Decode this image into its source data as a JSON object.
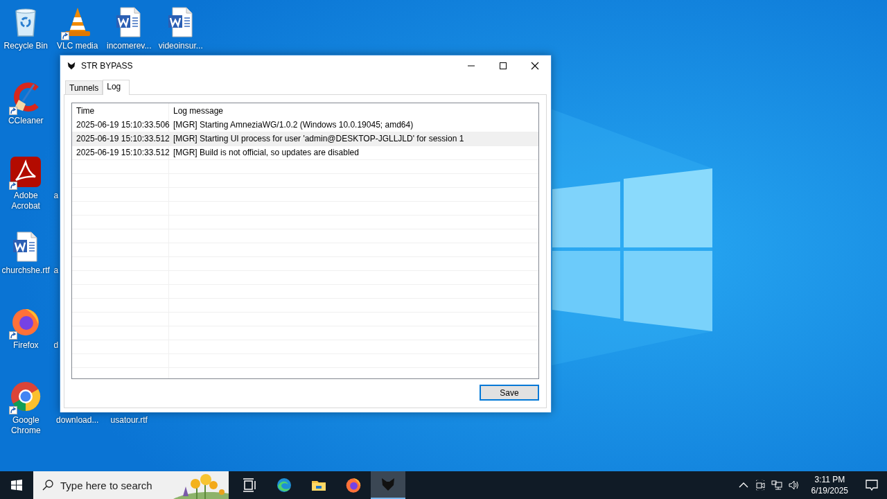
{
  "desktop": {
    "columns": [
      [
        {
          "kind": "recycle_bin",
          "label": "Recycle Bin"
        },
        {
          "kind": "ccleaner",
          "label": "CCleaner",
          "shortcut": true
        },
        {
          "kind": "acrobat",
          "label": "Adobe Acrobat",
          "shortcut": true
        },
        {
          "kind": "word",
          "label": "churchshe.rtf"
        },
        {
          "kind": "firefox",
          "label": "Firefox",
          "shortcut": true
        },
        {
          "kind": "chrome",
          "label": "Google Chrome",
          "shortcut": true
        }
      ],
      [
        {
          "kind": "vlc",
          "label": "VLC media",
          "shortcut": true
        },
        null,
        {
          "kind": "cut",
          "label": "a"
        },
        {
          "kind": "cut",
          "label": "a"
        },
        {
          "kind": "cut",
          "label": "d"
        },
        {
          "kind": "covered",
          "label": "download..."
        }
      ],
      [
        {
          "kind": "word",
          "label": "incomerev..."
        },
        null,
        null,
        null,
        null,
        {
          "kind": "covered",
          "label": "usatour.rtf"
        }
      ],
      [
        {
          "kind": "word",
          "label": "videoinsur..."
        }
      ]
    ]
  },
  "window": {
    "title": "STR BYPASS",
    "tabs": [
      {
        "label": "Tunnels",
        "selected": false
      },
      {
        "label": "Log",
        "selected": true
      }
    ],
    "log": {
      "columns": [
        "Time",
        "Log message"
      ],
      "rows": [
        {
          "time": "2025-06-19 15:10:33.506",
          "message": "[MGR] Starting AmneziaWG/1.0.2 (Windows 10.0.19045; amd64)",
          "selected": false
        },
        {
          "time": "2025-06-19 15:10:33.512",
          "message": "[MGR] Starting UI process for user 'admin@DESKTOP-JGLLJLD' for session 1",
          "selected": true
        },
        {
          "time": "2025-06-19 15:10:33.512",
          "message": "[MGR] Build is not official, so updates are disabled",
          "selected": false
        }
      ]
    },
    "buttons": [
      {
        "label": "Save",
        "default": true
      }
    ]
  },
  "taskbar": {
    "search": {
      "placeholder": "Type here to search"
    },
    "apps": [
      {
        "kind": "task_view",
        "active": false
      },
      {
        "kind": "edge",
        "active": false
      },
      {
        "kind": "explorer",
        "active": false
      },
      {
        "kind": "firefox",
        "active": false
      },
      {
        "kind": "str_bypass",
        "active": true
      }
    ],
    "tray": {
      "time": "3:11 PM",
      "date": "6/19/2025"
    }
  }
}
